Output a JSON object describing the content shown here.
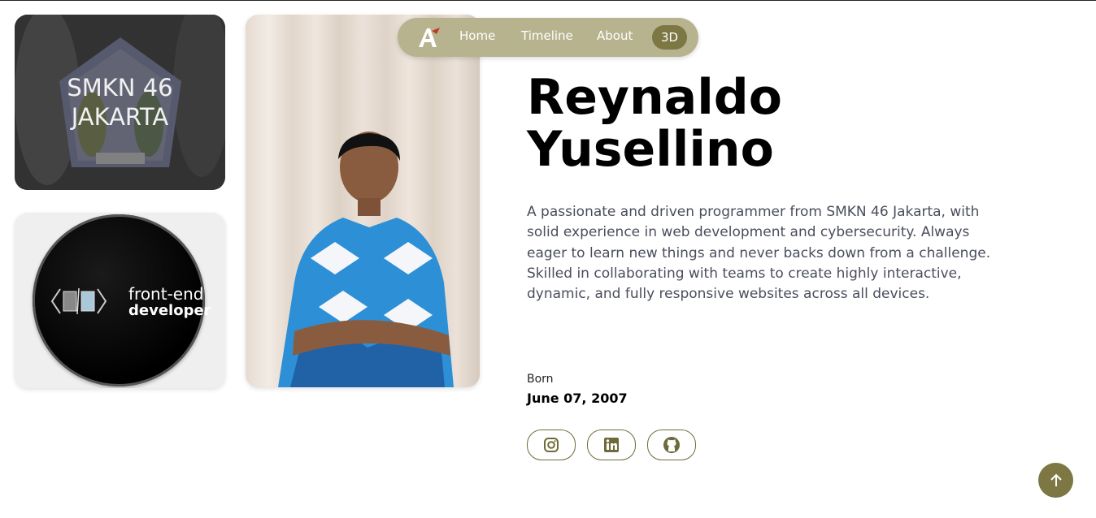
{
  "nav": {
    "links": [
      "Home",
      "Timeline",
      "About"
    ],
    "mode_button": "3D",
    "logo_icon": "stylized-a-logo-icon"
  },
  "cards": {
    "school_title_line1": "SMKN 46",
    "school_title_line2": "JAKARTA",
    "badge_line1": "front-end",
    "badge_line2": "developer"
  },
  "profile": {
    "name_line1": "Reynaldo",
    "name_line2": "Yusellino",
    "bio": "A passionate and driven programmer from SMKN 46 Jakarta, with solid experience in web development and cybersecurity. Always eager to learn new things and never backs down from a challenge. Skilled in collaborating with teams to create highly interactive, dynamic, and fully responsive websites across all devices.",
    "born_label": "Born",
    "born_value": "June 07, 2007"
  },
  "social": [
    "instagram-icon",
    "linkedin-icon",
    "github-icon"
  ],
  "colors": {
    "accent": "#7d7744",
    "nav_bg": "#b7b38e",
    "bio_text": "#4a4e5c"
  }
}
